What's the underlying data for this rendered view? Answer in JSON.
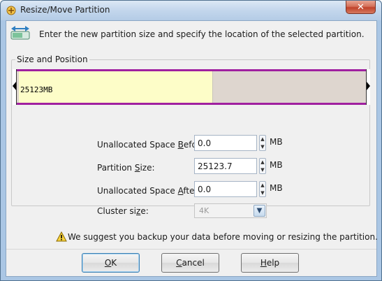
{
  "window": {
    "title": "Resize/Move Partition",
    "close_glyph": "✕"
  },
  "header": {
    "icon": "resize-partition-icon",
    "instruction": "Enter the new partition size and specify the location of the selected partition."
  },
  "group": {
    "label": "Size and Position"
  },
  "partition_bar": {
    "label": "25123MB",
    "used_fraction": 0.55,
    "used_color": "#fdfdc8",
    "free_color": "#ded6cf",
    "border_color": "#a020a0"
  },
  "fields": {
    "before": {
      "label_pre": "Unallocated Space ",
      "label_key": "B",
      "label_post": "efore:",
      "value": "0.0",
      "unit": "MB"
    },
    "size": {
      "label_pre": "Partition ",
      "label_key": "S",
      "label_post": "ize:",
      "value": "25123.7",
      "unit": "MB"
    },
    "after": {
      "label_pre": "Unallocated Space ",
      "label_key": "A",
      "label_post": "fter:",
      "value": "0.0",
      "unit": "MB"
    },
    "cluster": {
      "label_pre": "Cluster si",
      "label_key": "z",
      "label_post": "e:",
      "value": "4K"
    }
  },
  "warning": {
    "text": "We suggest you backup your data before moving or resizing the partition."
  },
  "buttons": {
    "ok": {
      "key": "O",
      "rest": "K"
    },
    "cancel": {
      "key": "C",
      "rest": "ancel"
    },
    "help": {
      "key": "H",
      "rest": "elp"
    }
  }
}
